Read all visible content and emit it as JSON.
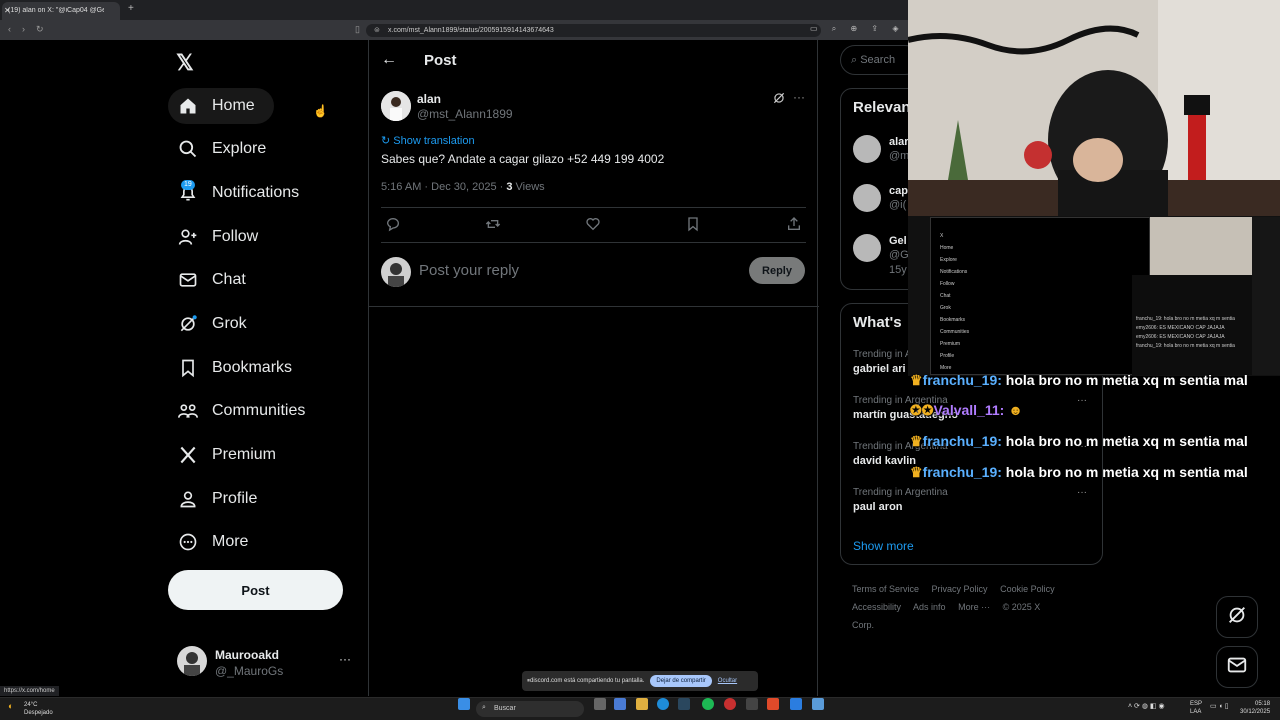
{
  "browser": {
    "tab_title": "(19) alan on X: \"@iCap04 @Ger",
    "url": "x.com/mst_Alann1899/status/2005915914143674643",
    "status_url": "https://x.com/home"
  },
  "nav": {
    "items": [
      {
        "label": "Home",
        "icon": "home-icon"
      },
      {
        "label": "Explore",
        "icon": "search-icon"
      },
      {
        "label": "Notifications",
        "icon": "bell-icon"
      },
      {
        "label": "Follow",
        "icon": "follow-icon"
      },
      {
        "label": "Chat",
        "icon": "mail-icon"
      },
      {
        "label": "Grok",
        "icon": "grok-icon"
      },
      {
        "label": "Bookmarks",
        "icon": "bookmark-icon"
      },
      {
        "label": "Communities",
        "icon": "communities-icon"
      },
      {
        "label": "Premium",
        "icon": "x-icon"
      },
      {
        "label": "Profile",
        "icon": "user-icon"
      },
      {
        "label": "More",
        "icon": "more-circle-icon"
      }
    ],
    "notifications_badge": "19",
    "post_button": "Post",
    "account": {
      "name": "Maurooakd",
      "handle": "@_MauroGs",
      "more": "···"
    }
  },
  "main": {
    "header": "Post",
    "tweet": {
      "name": "alan",
      "handle": "@mst_Alann1899",
      "show_translation": "Show translation",
      "text": "Sabes que?  Andate a cagar gilazo +52 449 199 4002",
      "time": "5:16 AM · Dec 30, 2025 · ",
      "views_count": "3",
      "views_label": " Views"
    },
    "reply": {
      "placeholder": "Post your reply",
      "button": "Reply"
    }
  },
  "right": {
    "search_placeholder": "Search",
    "relevant_title": "Relevan",
    "relevant": [
      {
        "name": "alar",
        "handle": "@m"
      },
      {
        "name": "cap",
        "handle": "@i("
      },
      {
        "name": "Gel",
        "handle": "@G",
        "extra": "15y"
      }
    ],
    "whats_title": "What's",
    "trends": [
      {
        "context": "Trending in A",
        "title": "gabriel ari"
      },
      {
        "context": "Trending in Argentina",
        "title": "martín guastadegno"
      },
      {
        "context": "Trending in Argentina",
        "title": "david kavlin"
      },
      {
        "context": "Trending in Argentina",
        "title": "paul aron"
      }
    ],
    "show_more": "Show more",
    "footer": [
      "Terms of Service",
      "Privacy Policy",
      "Cookie Policy",
      "Accessibility",
      "Ads info",
      "More ···",
      "© 2025 X Corp."
    ]
  },
  "chat": [
    {
      "user": "franchu_19:",
      "msg": " hola bro no m metia xq m sentia mal"
    },
    {
      "user": "Valvall_11:",
      "msg": ""
    },
    {
      "user": "franchu_19:",
      "msg": " hola bro no m metia xq m sentia mal"
    },
    {
      "user": "franchu_19:",
      "msg": " hola bro no m metia xq m sentia mal"
    }
  ],
  "share_bar": {
    "text": "discord.com está compartiendo tu pantalla.",
    "stop": "Dejar de compartir",
    "hide": "Ocultar"
  },
  "taskbar": {
    "weather_temp": "24°C",
    "weather_desc": "Despejado",
    "search": "Buscar",
    "lang1": "ESP",
    "lang2": "LAA",
    "time": "05:18",
    "date": "30/12/2025"
  },
  "colors": {
    "accent": "#1d9bf0",
    "background": "#000000",
    "border": "#2f3336",
    "muted": "#71767b"
  }
}
